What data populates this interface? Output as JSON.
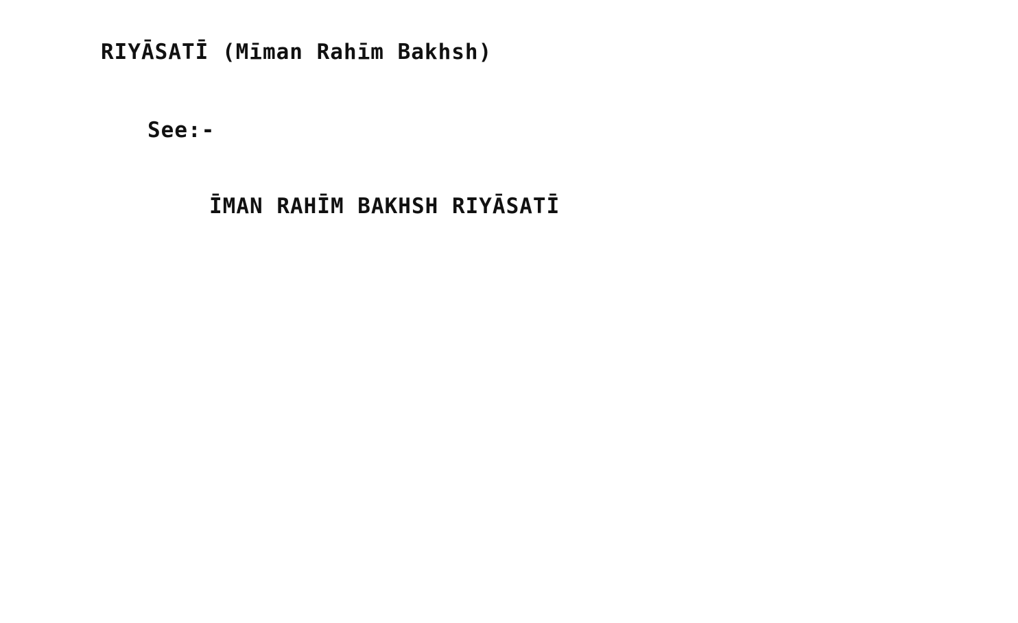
{
  "card": {
    "heading": "RIYĀSATĪ (Mīman Rahīm Bakhsh)",
    "see_label": "See:-",
    "reference": "ĪMAN RAHĪM BAKHSH RIYĀSATĪ"
  }
}
